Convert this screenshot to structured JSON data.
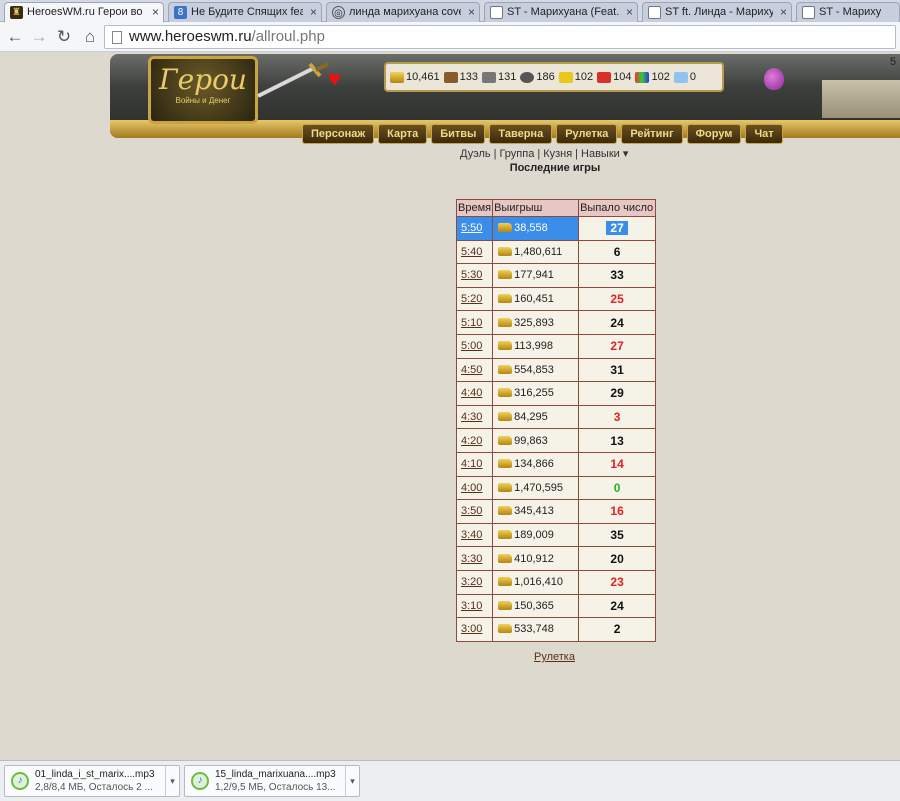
{
  "browser": {
    "tabs": [
      {
        "title": "HeroesWM.ru Герои во",
        "active": true,
        "icon": "heroes-favicon"
      },
      {
        "title": "Не Будите Спящих feat",
        "active": false,
        "icon": "google-favicon"
      },
      {
        "title": "линда марихуана cover",
        "active": false,
        "icon": "search-favicon"
      },
      {
        "title": "ST - Марихуана (Feat.",
        "active": false,
        "icon": "page-favicon"
      },
      {
        "title": "ST ft. Линда - Марихуа",
        "active": false,
        "icon": "page-favicon"
      },
      {
        "title": "ST - Марихуана (",
        "active": false,
        "icon": "page-favicon"
      }
    ],
    "url_host": "www.heroeswm.ru",
    "url_path": "/allroul.php"
  },
  "game": {
    "logo_title": "Герои",
    "logo_subtitle": "Войны и Денег",
    "resources": [
      {
        "icon": "gold-icon",
        "value": "10,461"
      },
      {
        "icon": "wood-icon",
        "value": "133"
      },
      {
        "icon": "ore-icon",
        "value": "131"
      },
      {
        "icon": "mercury-icon",
        "value": "186"
      },
      {
        "icon": "sulfur-icon",
        "value": "102"
      },
      {
        "icon": "crystal-icon",
        "value": "104"
      },
      {
        "icon": "gems-icon",
        "value": "102"
      },
      {
        "icon": "diamond-icon",
        "value": "0"
      }
    ],
    "edge_number": "5",
    "menu": [
      "Персонаж",
      "Карта",
      "Битвы",
      "Таверна",
      "Рулетка",
      "Рейтинг",
      "Форум",
      "Чат"
    ],
    "subnav": {
      "duel": "Дуэль",
      "sep": "|",
      "group": "Группа",
      "forge": "Кузня",
      "skills": "Навыки ▾"
    }
  },
  "page": {
    "title": "Последние игры",
    "table": {
      "headers": [
        "Время",
        "Выигрыш",
        "Выпало число"
      ],
      "rows": [
        {
          "time": "5:50",
          "win": "38,558",
          "number": "27",
          "color": "red",
          "selected": true
        },
        {
          "time": "5:40",
          "win": "1,480,611",
          "number": "6",
          "color": "black"
        },
        {
          "time": "5:30",
          "win": "177,941",
          "number": "33",
          "color": "black"
        },
        {
          "time": "5:20",
          "win": "160,451",
          "number": "25",
          "color": "red"
        },
        {
          "time": "5:10",
          "win": "325,893",
          "number": "24",
          "color": "black"
        },
        {
          "time": "5:00",
          "win": "113,998",
          "number": "27",
          "color": "red"
        },
        {
          "time": "4:50",
          "win": "554,853",
          "number": "31",
          "color": "black"
        },
        {
          "time": "4:40",
          "win": "316,255",
          "number": "29",
          "color": "black"
        },
        {
          "time": "4:30",
          "win": "84,295",
          "number": "3",
          "color": "red"
        },
        {
          "time": "4:20",
          "win": "99,863",
          "number": "13",
          "color": "black"
        },
        {
          "time": "4:10",
          "win": "134,866",
          "number": "14",
          "color": "red"
        },
        {
          "time": "4:00",
          "win": "1,470,595",
          "number": "0",
          "color": "green"
        },
        {
          "time": "3:50",
          "win": "345,413",
          "number": "16",
          "color": "red"
        },
        {
          "time": "3:40",
          "win": "189,009",
          "number": "35",
          "color": "black"
        },
        {
          "time": "3:30",
          "win": "410,912",
          "number": "20",
          "color": "black"
        },
        {
          "time": "3:20",
          "win": "1,016,410",
          "number": "23",
          "color": "red"
        },
        {
          "time": "3:10",
          "win": "150,365",
          "number": "24",
          "color": "black"
        },
        {
          "time": "3:00",
          "win": "533,748",
          "number": "2",
          "color": "black"
        }
      ]
    },
    "roulette_link": "Рулетка"
  },
  "downloads": [
    {
      "name": "01_linda_i_st_marix....mp3",
      "status": "2,8/8,4 МБ, Осталось 2 ..."
    },
    {
      "name": "15_linda_marixuana....mp3",
      "status": "1,2/9,5 МБ, Осталось 13..."
    }
  ],
  "colors": {
    "red_number": "#e02222",
    "black_number": "#111111",
    "green_number": "#22b522",
    "selection": "#3a8de8"
  }
}
